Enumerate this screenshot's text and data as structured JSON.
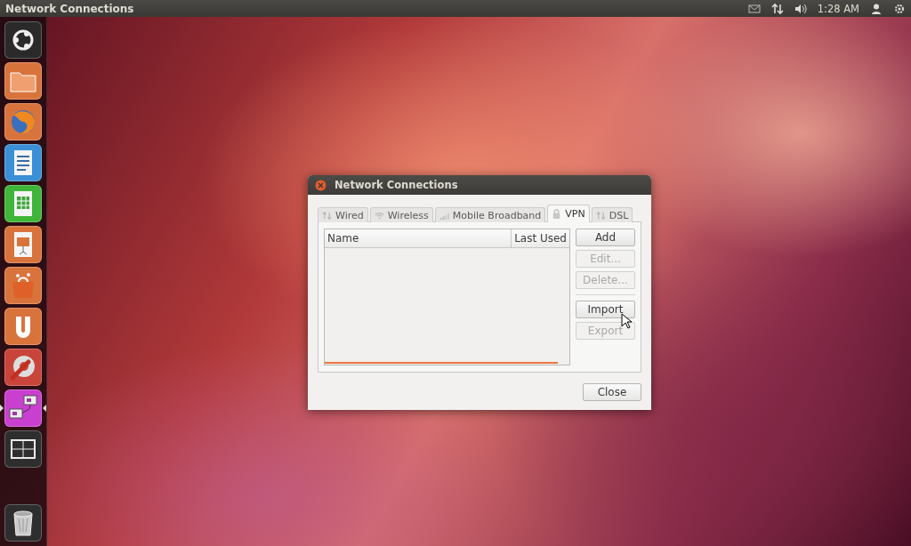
{
  "top_bar": {
    "app_title": "Network Connections",
    "clock": "1:28 AM"
  },
  "launcher": {
    "items": [
      {
        "kind": "dash",
        "active": false
      },
      {
        "kind": "files",
        "active": false
      },
      {
        "kind": "browser",
        "active": false
      },
      {
        "kind": "writer",
        "active": false
      },
      {
        "kind": "calc",
        "active": false
      },
      {
        "kind": "impress",
        "active": false
      },
      {
        "kind": "store",
        "active": false
      },
      {
        "kind": "cloud",
        "active": false
      },
      {
        "kind": "settings",
        "active": false
      },
      {
        "kind": "network",
        "active": true
      },
      {
        "kind": "workspaces",
        "active": false
      }
    ],
    "trash": {
      "kind": "trash"
    }
  },
  "dialog": {
    "title": "Network Connections",
    "tabs": [
      {
        "label": "Wired",
        "kind": "wired",
        "selected": false
      },
      {
        "label": "Wireless",
        "kind": "wireless",
        "selected": false
      },
      {
        "label": "Mobile Broadband",
        "kind": "mobile",
        "selected": false
      },
      {
        "label": "VPN",
        "kind": "vpn",
        "selected": true
      },
      {
        "label": "DSL",
        "kind": "dsl",
        "selected": false
      }
    ],
    "table": {
      "columns": [
        "Name",
        "Last Used"
      ]
    },
    "buttons": [
      {
        "label": "Add",
        "disabled": false
      },
      {
        "label": "Edit...",
        "disabled": true
      },
      {
        "label": "Delete...",
        "disabled": true
      },
      {
        "label": "Import",
        "disabled": false,
        "separator_before": true
      },
      {
        "label": "Export",
        "disabled": true
      }
    ],
    "close_button": "Close"
  }
}
